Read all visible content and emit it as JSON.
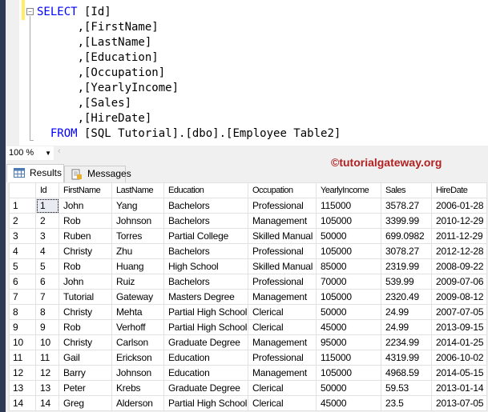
{
  "editor": {
    "lines": [
      {
        "kw": "SELECT",
        "rest": " [Id]"
      },
      {
        "kw": "",
        "rest": "      ,[FirstName]"
      },
      {
        "kw": "",
        "rest": "      ,[LastName]"
      },
      {
        "kw": "",
        "rest": "      ,[Education]"
      },
      {
        "kw": "",
        "rest": "      ,[Occupation]"
      },
      {
        "kw": "",
        "rest": "      ,[YearlyIncome]"
      },
      {
        "kw": "",
        "rest": "      ,[Sales]"
      },
      {
        "kw": "",
        "rest": "      ,[HireDate]"
      },
      {
        "kw": "  FROM",
        "rest": " [SQL Tutorial].[dbo].[Employee Table2]"
      }
    ]
  },
  "zoom": {
    "value": "100 %"
  },
  "tabs": {
    "results": "Results",
    "messages": "Messages"
  },
  "watermark": "©tutorialgateway.org",
  "grid": {
    "columns": [
      "",
      "Id",
      "FirstName",
      "LastName",
      "Education",
      "Occupation",
      "YearlyIncome",
      "Sales",
      "HireDate"
    ],
    "rows": [
      [
        "1",
        "1",
        "John",
        "Yang",
        "Bachelors",
        "Professional",
        "115000",
        "3578.27",
        "2006-01-28"
      ],
      [
        "2",
        "2",
        "Rob",
        "Johnson",
        "Bachelors",
        "Management",
        "105000",
        "3399.99",
        "2010-12-29"
      ],
      [
        "3",
        "3",
        "Ruben",
        "Torres",
        "Partial College",
        "Skilled Manual",
        "50000",
        "699.0982",
        "2011-12-29"
      ],
      [
        "4",
        "4",
        "Christy",
        "Zhu",
        "Bachelors",
        "Professional",
        "105000",
        "3078.27",
        "2012-12-28"
      ],
      [
        "5",
        "5",
        "Rob",
        "Huang",
        "High School",
        "Skilled Manual",
        "85000",
        "2319.99",
        "2008-09-22"
      ],
      [
        "6",
        "6",
        "John",
        "Ruiz",
        "Bachelors",
        "Professional",
        "70000",
        "539.99",
        "2009-07-06"
      ],
      [
        "7",
        "7",
        "Tutorial",
        "Gateway",
        "Masters Degree",
        "Management",
        "105000",
        "2320.49",
        "2009-08-12"
      ],
      [
        "8",
        "8",
        "Christy",
        "Mehta",
        "Partial High School",
        "Clerical",
        "50000",
        "24.99",
        "2007-07-05"
      ],
      [
        "9",
        "9",
        "Rob",
        "Verhoff",
        "Partial High School",
        "Clerical",
        "45000",
        "24.99",
        "2013-09-15"
      ],
      [
        "10",
        "10",
        "Christy",
        "Carlson",
        "Graduate Degree",
        "Management",
        "95000",
        "2234.99",
        "2014-01-25"
      ],
      [
        "11",
        "11",
        "Gail",
        "Erickson",
        "Education",
        "Professional",
        "115000",
        "4319.99",
        "2006-10-02"
      ],
      [
        "12",
        "12",
        "Barry",
        "Johnson",
        "Education",
        "Management",
        "105000",
        "4968.59",
        "2014-05-15"
      ],
      [
        "13",
        "13",
        "Peter",
        "Krebs",
        "Graduate Degree",
        "Clerical",
        "50000",
        "59.53",
        "2013-01-14"
      ],
      [
        "14",
        "14",
        "Greg",
        "Alderson",
        "Partial High School",
        "Clerical",
        "45000",
        "23.5",
        "2013-07-05"
      ]
    ]
  }
}
